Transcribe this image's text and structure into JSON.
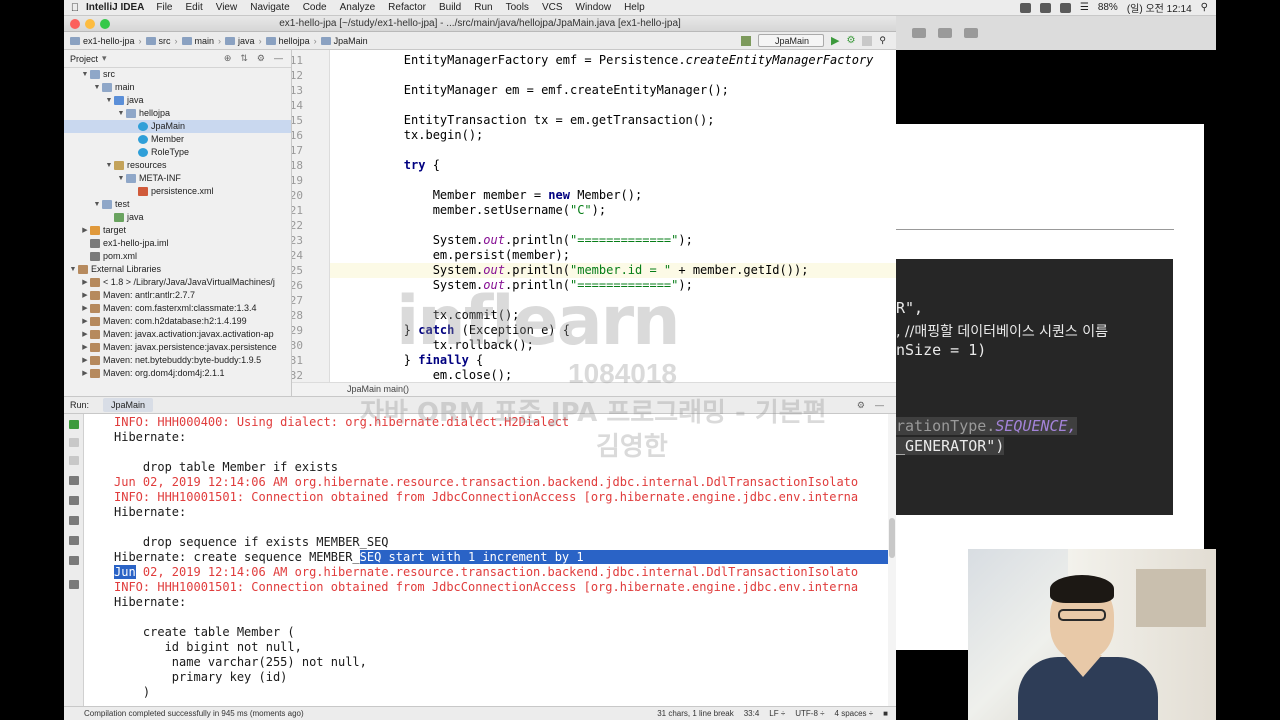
{
  "menubar": {
    "app_name": "IntelliJ IDEA",
    "items": [
      "File",
      "Edit",
      "View",
      "Navigate",
      "Code",
      "Analyze",
      "Refactor",
      "Build",
      "Run",
      "Tools",
      "VCS",
      "Window",
      "Help"
    ],
    "battery": "88%",
    "clock": "(일) 오전 12:14"
  },
  "window": {
    "title": "ex1-hello-jpa [~/study/ex1-hello-jpa] - .../src/main/java/hellojpa/JpaMain.java [ex1-hello-jpa]"
  },
  "navbar": {
    "breadcrumbs": [
      "ex1-hello-jpa",
      "src",
      "main",
      "java",
      "hellojpa",
      "JpaMain"
    ],
    "run_config": "JpaMain"
  },
  "project_panel": {
    "title": "Project",
    "tree": [
      {
        "label": "src",
        "depth": 1,
        "icon": "folder",
        "open": true
      },
      {
        "label": "main",
        "depth": 2,
        "icon": "folder",
        "open": true
      },
      {
        "label": "java",
        "depth": 3,
        "icon": "src",
        "open": true
      },
      {
        "label": "hellojpa",
        "depth": 4,
        "icon": "folder",
        "open": true
      },
      {
        "label": "JpaMain",
        "depth": 5,
        "icon": "class",
        "selected": true
      },
      {
        "label": "Member",
        "depth": 5,
        "icon": "class"
      },
      {
        "label": "RoleType",
        "depth": 5,
        "icon": "class"
      },
      {
        "label": "resources",
        "depth": 3,
        "icon": "res",
        "open": true
      },
      {
        "label": "META-INF",
        "depth": 4,
        "icon": "folder",
        "open": true
      },
      {
        "label": "persistence.xml",
        "depth": 5,
        "icon": "xml"
      },
      {
        "label": "test",
        "depth": 2,
        "icon": "folder",
        "open": true
      },
      {
        "label": "java",
        "depth": 3,
        "icon": "test"
      },
      {
        "label": "target",
        "depth": 1,
        "icon": "target",
        "open": false
      },
      {
        "label": "ex1-hello-jpa.iml",
        "depth": 1,
        "icon": "iml"
      },
      {
        "label": "pom.xml",
        "depth": 1,
        "icon": "iml"
      },
      {
        "label": "External Libraries",
        "depth": 0,
        "icon": "lib",
        "open": true
      },
      {
        "label": "< 1.8 > /Library/Java/JavaVirtualMachines/j",
        "depth": 1,
        "icon": "lib",
        "open": false
      },
      {
        "label": "Maven: antlr:antlr:2.7.7",
        "depth": 1,
        "icon": "lib",
        "open": false
      },
      {
        "label": "Maven: com.fasterxml:classmate:1.3.4",
        "depth": 1,
        "icon": "lib",
        "open": false
      },
      {
        "label": "Maven: com.h2database:h2:1.4.199",
        "depth": 1,
        "icon": "lib",
        "open": false
      },
      {
        "label": "Maven: javax.activation:javax.activation-ap",
        "depth": 1,
        "icon": "lib",
        "open": false
      },
      {
        "label": "Maven: javax.persistence:javax.persistence",
        "depth": 1,
        "icon": "lib",
        "open": false
      },
      {
        "label": "Maven: net.bytebuddy:byte-buddy:1.9.5",
        "depth": 1,
        "icon": "lib",
        "open": false
      },
      {
        "label": "Maven: org.dom4j:dom4j:2.1.1",
        "depth": 1,
        "icon": "lib",
        "open": false
      }
    ]
  },
  "editor": {
    "lines": [
      {
        "n": "11",
        "html": "        EntityManagerFactory emf = Persistence.<span class='it'>createEntityManagerFactory</span>"
      },
      {
        "n": "12",
        "html": ""
      },
      {
        "n": "13",
        "html": "        EntityManager em = emf.createEntityManager();"
      },
      {
        "n": "14",
        "html": ""
      },
      {
        "n": "15",
        "html": "        EntityTransaction tx = em.getTransaction();"
      },
      {
        "n": "16",
        "html": "        tx.begin();"
      },
      {
        "n": "17",
        "html": ""
      },
      {
        "n": "18",
        "html": "        <span class='kw'>try</span> {"
      },
      {
        "n": "19",
        "html": ""
      },
      {
        "n": "20",
        "html": "            Member member = <span class='kw'>new</span> Member();"
      },
      {
        "n": "21",
        "html": "            member.setUsername(<span class='str'>\"C\"</span>);"
      },
      {
        "n": "22",
        "html": ""
      },
      {
        "n": "23",
        "html": "            System.<span class='fld'>out</span>.println(<span class='str'>\"=============\"</span>);"
      },
      {
        "n": "24",
        "html": "            em.persist(member);"
      },
      {
        "n": "25",
        "html": "            System.<span class='fld'>out</span>.println(<span class='str'>\"member.id = \"</span> + member.getId());",
        "current": true
      },
      {
        "n": "26",
        "html": "            System.<span class='fld'>out</span>.println(<span class='str'>\"=============\"</span>);"
      },
      {
        "n": "27",
        "html": ""
      },
      {
        "n": "28",
        "html": "            tx.commit();"
      },
      {
        "n": "29",
        "html": "        } <span class='kw'>catch</span> (Exception e) {"
      },
      {
        "n": "30",
        "html": "            tx.rollback();"
      },
      {
        "n": "31",
        "html": "        } <span class='kw'>finally</span> {"
      },
      {
        "n": "32",
        "html": "            em.close();"
      }
    ],
    "footer_crumbs": "JpaMain    main()"
  },
  "run_panel": {
    "label": "Run:",
    "tab": "JpaMain",
    "console": [
      {
        "t": "err",
        "text": "INFO: HHH000400: Using dialect: org.hibernate.dialect.H2Dialect"
      },
      {
        "t": "out",
        "text": "Hibernate: "
      },
      {
        "t": "out",
        "text": ""
      },
      {
        "t": "out",
        "text": "    drop table Member if exists"
      },
      {
        "t": "err",
        "text": "Jun 02, 2019 12:14:06 AM org.hibernate.resource.transaction.backend.jdbc.internal.DdlTransactionIsolato"
      },
      {
        "t": "err",
        "text": "INFO: HHH10001501: Connection obtained from JdbcConnectionAccess [org.hibernate.engine.jdbc.env.interna"
      },
      {
        "t": "out",
        "text": "Hibernate: "
      },
      {
        "t": "out",
        "text": ""
      },
      {
        "t": "out",
        "text": "    drop sequence if exists MEMBER_SEQ"
      },
      {
        "t": "out",
        "text": "Hibernate: create sequence MEMBER_SEQ start with 1 increment by 1",
        "hl_from": 34
      },
      {
        "t": "err",
        "text": "Jun 02, 2019 12:14:06 AM org.hibernate.resource.transaction.backend.jdbc.internal.DdlTransactionIsolato",
        "hl_to": 3
      },
      {
        "t": "err",
        "text": "INFO: HHH10001501: Connection obtained from JdbcConnectionAccess [org.hibernate.engine.jdbc.env.interna"
      },
      {
        "t": "out",
        "text": "Hibernate: "
      },
      {
        "t": "out",
        "text": ""
      },
      {
        "t": "out",
        "text": "    create table Member ("
      },
      {
        "t": "out",
        "text": "       id bigint not null,"
      },
      {
        "t": "out",
        "text": "        name varchar(255) not null,"
      },
      {
        "t": "out",
        "text": "        primary key (id)"
      },
      {
        "t": "out",
        "text": "    )"
      }
    ]
  },
  "statusbar": {
    "message": "Compilation completed successfully in 945 ms (moments ago)",
    "selection": "31 chars, 1 line break",
    "position": "33:4",
    "line_sep": "LF ÷",
    "encoding": "UTF-8 ÷",
    "indent": "4 spaces ÷"
  },
  "slide": {
    "line1": "R\",",
    "line2": ", //매핑할 데이터베이스 시퀀스 이름",
    "line3": "nSize = 1)",
    "line4_a": "rationType.",
    "line4_b": "SEQUENCE,",
    "line5": "_GENERATOR\")"
  },
  "watermark": {
    "logo": "inflearn",
    "number": "1084018",
    "course": "자바 ORM 표준 JPA 프로그래밍 - 기본편",
    "author": "김영한"
  },
  "colors": {
    "error_text": "#e03c3c",
    "selection": "#2a63c6",
    "keyword": "#000080",
    "string": "#067d17"
  }
}
